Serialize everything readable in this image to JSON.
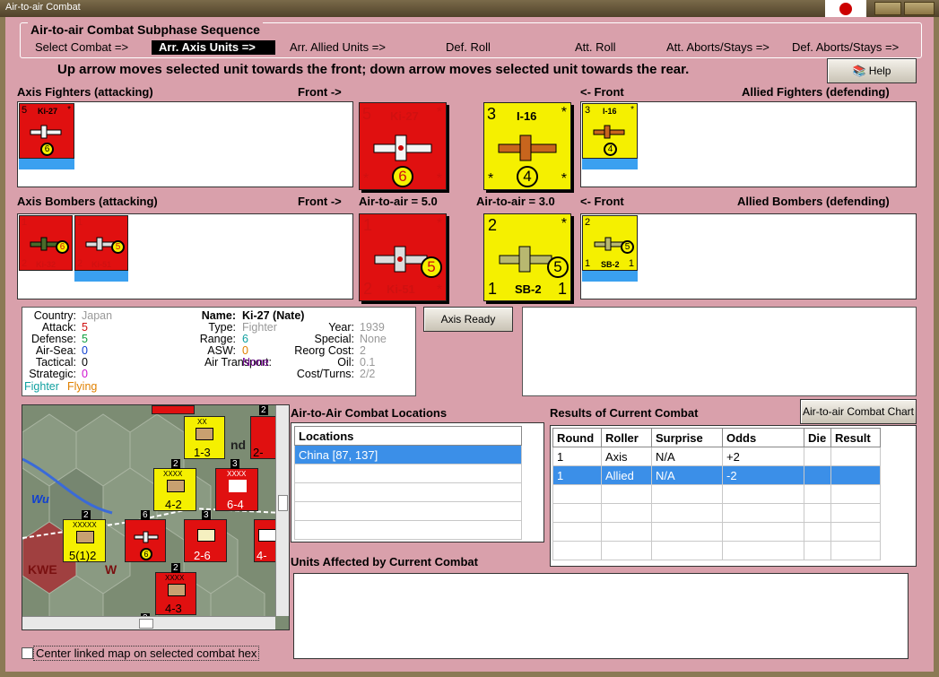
{
  "window": {
    "title": "Air-to-air Combat"
  },
  "sequence": {
    "title": "Air-to-air Combat Subphase Sequence",
    "steps": [
      "Select Combat =>",
      "Arr. Axis Units =>",
      "Arr. Allied Units =>",
      "Def. Roll",
      "Att. Roll",
      "Att. Aborts/Stays =>",
      "Def. Aborts/Stays =>"
    ],
    "selected": "Arr. Axis Units =>"
  },
  "instruction": "Up arrow moves selected unit towards the front; down arrow moves selected unit towards the rear.",
  "help_label": "Help",
  "labels": {
    "axis_fighters": "Axis Fighters (attacking)",
    "front_right": "Front ->",
    "front_left": "<- Front",
    "allied_fighters": "Allied Fighters (defending)",
    "axis_bombers": "Axis Bombers (attacking)",
    "axis_air_to_air": "Air-to-air = 5.0",
    "allied_air_to_air": "Air-to-air = 3.0",
    "allied_bombers": "Allied Bombers (defending)"
  },
  "counters": {
    "ki27": {
      "name": "Ki-27",
      "attack": "5",
      "range": "6"
    },
    "i16": {
      "name": "I-16",
      "attack": "3",
      "range": "4"
    },
    "ki51": {
      "name": "Ki-51",
      "attack": "1",
      "defense": "2",
      "range": "5"
    },
    "sb2": {
      "name": "SB-2",
      "attack": "2",
      "defense": "1",
      "range": "5",
      "corner": "1"
    },
    "ki32": {
      "name": "Ki-32",
      "attack": "1",
      "defense": "2",
      "range": "6"
    },
    "star": "*"
  },
  "axis_ready_label": "Axis Ready",
  "unit_info": {
    "country_label": "Country:",
    "country": "Japan",
    "attack_label": "Attack:",
    "attack": "5",
    "defense_label": "Defense:",
    "defense": "5",
    "airsea_label": "Air-Sea:",
    "airsea": "0",
    "tactical_label": "Tactical:",
    "tactical": "0",
    "strategic_label": "Strategic:",
    "strategic": "0",
    "fighter": "Fighter",
    "flying": "Flying",
    "name_label": "Name:",
    "name": "Ki-27 (Nate)",
    "type_label": "Type:",
    "type": "Fighter",
    "range_label": "Range:",
    "range": "6",
    "asw_label": "ASW:",
    "asw": "0",
    "air_transport_label": "Air Transport:",
    "air_transport": "None",
    "year_label": "Year:",
    "year": "1939",
    "special_label": "Special:",
    "special": "None",
    "reorg_label": "Reorg Cost:",
    "reorg": "2",
    "oil_label": "Oil:",
    "oil": "0.1",
    "cost_label": "Cost/Turns:",
    "cost": "2/2"
  },
  "map": {
    "labels": {
      "wu": "Wu",
      "kwe": "KWE",
      "w": "W",
      "nd": "nd"
    },
    "units": [
      {
        "num": "1-3",
        "type": "XX",
        "color": "#f5f000"
      },
      {
        "num": "4-2",
        "type": "XXXX",
        "color": "#f5f000"
      },
      {
        "num": "6-4",
        "type": "XXXX",
        "color": "#e01010"
      },
      {
        "num": "5(1)2",
        "type": "XXXXX",
        "color": "#f5f000"
      },
      {
        "num": "2-6",
        "type": "",
        "color": "#e01010"
      },
      {
        "num": "4-3",
        "type": "XXXX",
        "color": "#e01010"
      },
      {
        "num": "2-",
        "type": "",
        "color": "#e01010"
      },
      {
        "num": "4-",
        "type": "",
        "color": "#e01010"
      }
    ],
    "badges": [
      "2",
      "3",
      "2",
      "3",
      "2",
      "6",
      "3",
      "2",
      "3"
    ]
  },
  "locations": {
    "title": "Air-to-Air Combat Locations",
    "header": "Locations",
    "items": [
      "China [87, 137]"
    ]
  },
  "results": {
    "title": "Results of Current Combat",
    "chart_button": "Air-to-air Combat Chart",
    "columns": [
      "Round",
      "Roller",
      "Surprise",
      "Odds",
      "Die",
      "Result"
    ],
    "rows": [
      [
        "1",
        "Axis",
        "N/A",
        "+2",
        "",
        ""
      ],
      [
        "1",
        "Allied",
        "N/A",
        "-2",
        "",
        ""
      ]
    ]
  },
  "units_affected": {
    "title": "Units Affected by Current Combat"
  },
  "center_map": {
    "label": "Center linked map on selected combat hex"
  }
}
